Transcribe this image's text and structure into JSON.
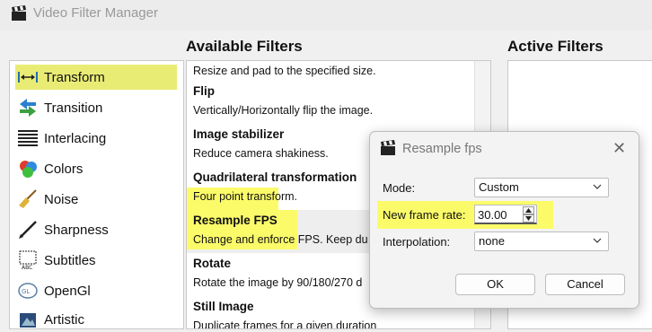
{
  "window": {
    "title": "Video Filter Manager"
  },
  "sections": {
    "available": "Available Filters",
    "active": "Active Filters"
  },
  "categories": [
    {
      "label": "Transform",
      "icon": "resize-arrows-icon",
      "selected": true
    },
    {
      "label": "Transition",
      "icon": "transition-arrows-icon"
    },
    {
      "label": "Interlacing",
      "icon": "interlacing-lines-icon"
    },
    {
      "label": "Colors",
      "icon": "color-palette-icon"
    },
    {
      "label": "Noise",
      "icon": "broom-icon"
    },
    {
      "label": "Sharpness",
      "icon": "pencil-icon"
    },
    {
      "label": "Subtitles",
      "icon": "subtitles-icon"
    },
    {
      "label": "OpenGl",
      "icon": "opengl-icon"
    },
    {
      "label": "Artistic",
      "icon": "artistic-icon"
    }
  ],
  "filters": [
    {
      "name": "",
      "desc": "Resize and pad to the specified size."
    },
    {
      "name": "Flip",
      "desc": "Vertically/Horizontally flip the image."
    },
    {
      "name": "Image stabilizer",
      "desc": "Reduce camera shakiness."
    },
    {
      "name": "Quadrilateral transformation",
      "desc": "Four point transform."
    },
    {
      "name": "Resample FPS",
      "desc": "Change and enforce FPS. Keep du"
    },
    {
      "name": "Rotate",
      "desc": "Rotate the image by 90/180/270 d"
    },
    {
      "name": "Still Image",
      "desc": "Duplicate frames for a given duration"
    }
  ],
  "dialog": {
    "title": "Resample fps",
    "mode_label": "Mode:",
    "mode_value": "Custom",
    "rate_label": "New frame rate:",
    "rate_value": "30.00",
    "interp_label": "Interpolation:",
    "interp_value": "none",
    "ok": "OK",
    "cancel": "Cancel"
  },
  "colors": {
    "highlight": "#fbfb6a",
    "selection": "#e9ec74"
  }
}
